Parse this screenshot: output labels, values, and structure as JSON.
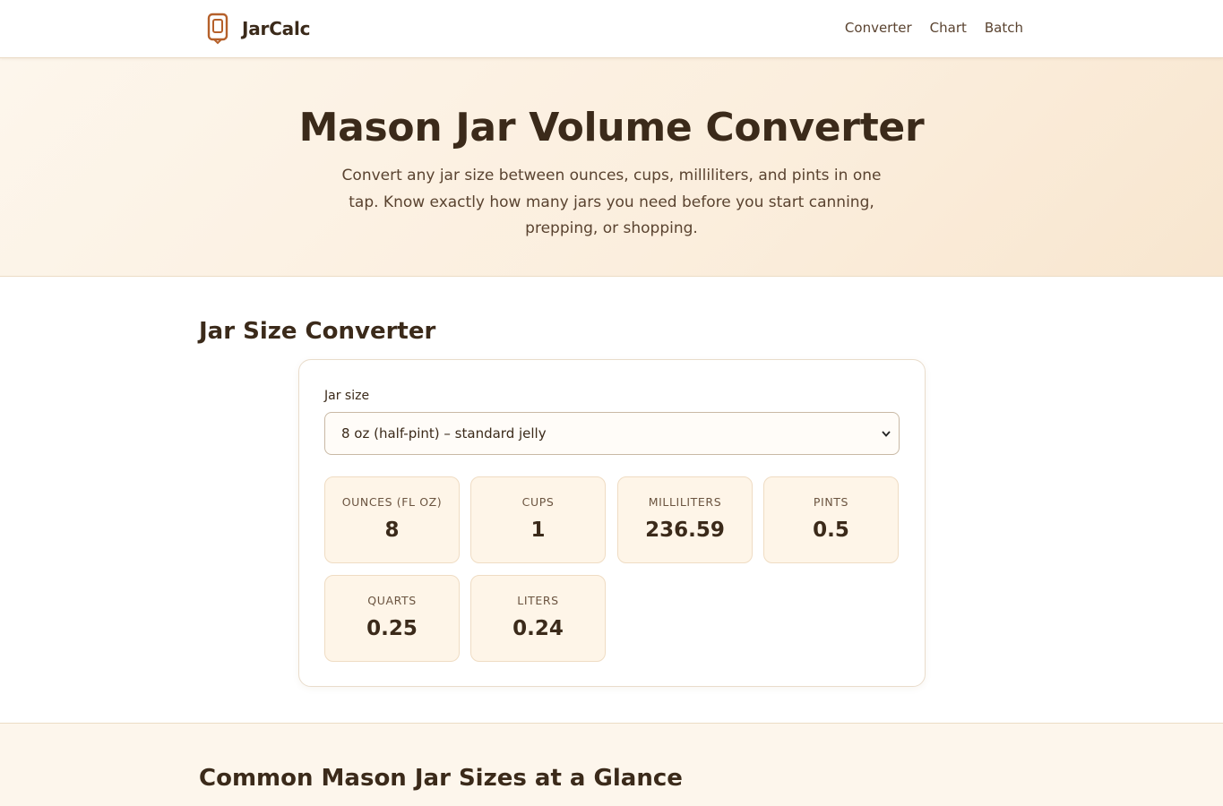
{
  "header": {
    "brand": "JarCalc",
    "nav": [
      "Converter",
      "Chart",
      "Batch"
    ]
  },
  "hero": {
    "title": "Mason Jar Volume Converter",
    "subtitle": "Convert any jar size between ounces, cups, milliliters, and pints in one tap. Know exactly how many jars you need before you start canning, prepping, or shopping."
  },
  "converter": {
    "section_title": "Jar Size Converter",
    "jar_size_label": "Jar size",
    "jar_size_selected": "8 oz (half-pint) – standard jelly",
    "results": [
      {
        "label": "Ounces (fl oz)",
        "value": "8"
      },
      {
        "label": "Cups",
        "value": "1"
      },
      {
        "label": "Milliliters",
        "value": "236.59"
      },
      {
        "label": "Pints",
        "value": "0.5"
      },
      {
        "label": "Quarts",
        "value": "0.25"
      },
      {
        "label": "Liters",
        "value": "0.24"
      }
    ]
  },
  "common_sizes": {
    "section_title": "Common Mason Jar Sizes at a Glance"
  },
  "colors": {
    "text": "#3b2a1a",
    "accent_icon": "#b5602a",
    "hero_bg": "#fbeedd",
    "stat_bg": "#fef5e8"
  },
  "icons": {
    "brand": "mason-jar-icon",
    "select": "chevron-down-icon"
  }
}
